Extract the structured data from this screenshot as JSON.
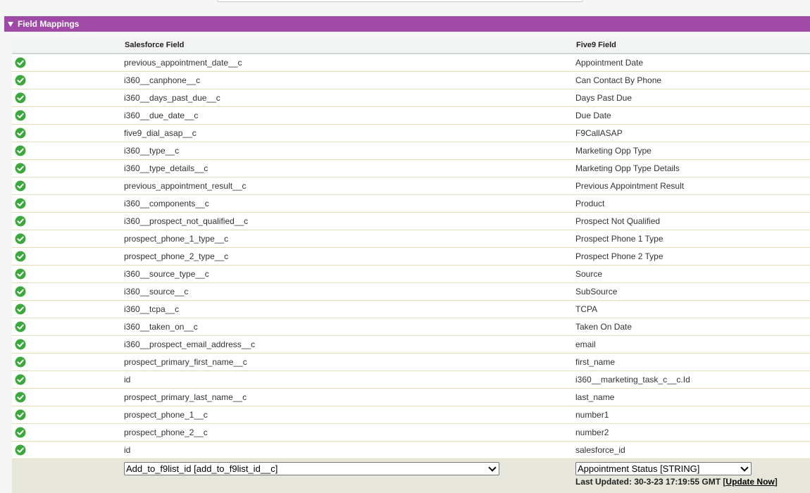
{
  "section": {
    "title": "Field Mappings"
  },
  "table": {
    "columns": {
      "salesforce": "Salesforce Field",
      "five9": "Five9 Field"
    },
    "rows": [
      {
        "salesforce": "previous_appointment_date__c",
        "five9": "Appointment Date"
      },
      {
        "salesforce": "i360__canphone__c",
        "five9": "Can Contact By Phone"
      },
      {
        "salesforce": "i360__days_past_due__c",
        "five9": "Days Past Due"
      },
      {
        "salesforce": "i360__due_date__c",
        "five9": "Due Date"
      },
      {
        "salesforce": "five9_dial_asap__c",
        "five9": "F9CallASAP"
      },
      {
        "salesforce": "i360__type__c",
        "five9": "Marketing Opp Type"
      },
      {
        "salesforce": "i360__type_details__c",
        "five9": "Marketing Opp Type Details"
      },
      {
        "salesforce": "previous_appointment_result__c",
        "five9": "Previous Appointment Result"
      },
      {
        "salesforce": "i360__components__c",
        "five9": "Product"
      },
      {
        "salesforce": "i360__prospect_not_qualified__c",
        "five9": "Prospect Not Qualified"
      },
      {
        "salesforce": "prospect_phone_1_type__c",
        "five9": "Prospect Phone 1 Type"
      },
      {
        "salesforce": "prospect_phone_2_type__c",
        "five9": "Prospect Phone 2 Type"
      },
      {
        "salesforce": "i360__source_type__c",
        "five9": "Source"
      },
      {
        "salesforce": "i360__source__c",
        "five9": "SubSource"
      },
      {
        "salesforce": "i360__tcpa__c",
        "five9": "TCPA"
      },
      {
        "salesforce": "i360__taken_on__c",
        "five9": "Taken On Date"
      },
      {
        "salesforce": "i360__prospect_email_address__c",
        "five9": "email"
      },
      {
        "salesforce": "prospect_primary_first_name__c",
        "five9": "first_name"
      },
      {
        "salesforce": "id",
        "five9": "i360__marketing_task_c__c.Id"
      },
      {
        "salesforce": "prospect_primary_last_name__c",
        "five9": "last_name"
      },
      {
        "salesforce": "prospect_phone_1__c",
        "five9": "number1"
      },
      {
        "salesforce": "prospect_phone_2__c",
        "five9": "number2"
      },
      {
        "salesforce": "id",
        "five9": "salesforce_id"
      }
    ]
  },
  "new_mapping": {
    "salesforce_selected": "Add_to_f9list_id [add_to_f9list_id__c]",
    "five9_selected": "Appointment Status [STRING]",
    "last_updated_label": "Last Updated: 30-3-23 17:19:55 GMT",
    "update_link_open": "[",
    "update_link": "Update Now",
    "update_link_close": "]"
  },
  "icons": {
    "row_status": "check-circle-icon",
    "section_toggle": "triangle-down-icon",
    "select_arrow": "chevron-down-icon"
  },
  "colors": {
    "section_header": "#a04aa7",
    "check_green": "#3aa83a",
    "new_row_bg": "#e6e6dc"
  }
}
